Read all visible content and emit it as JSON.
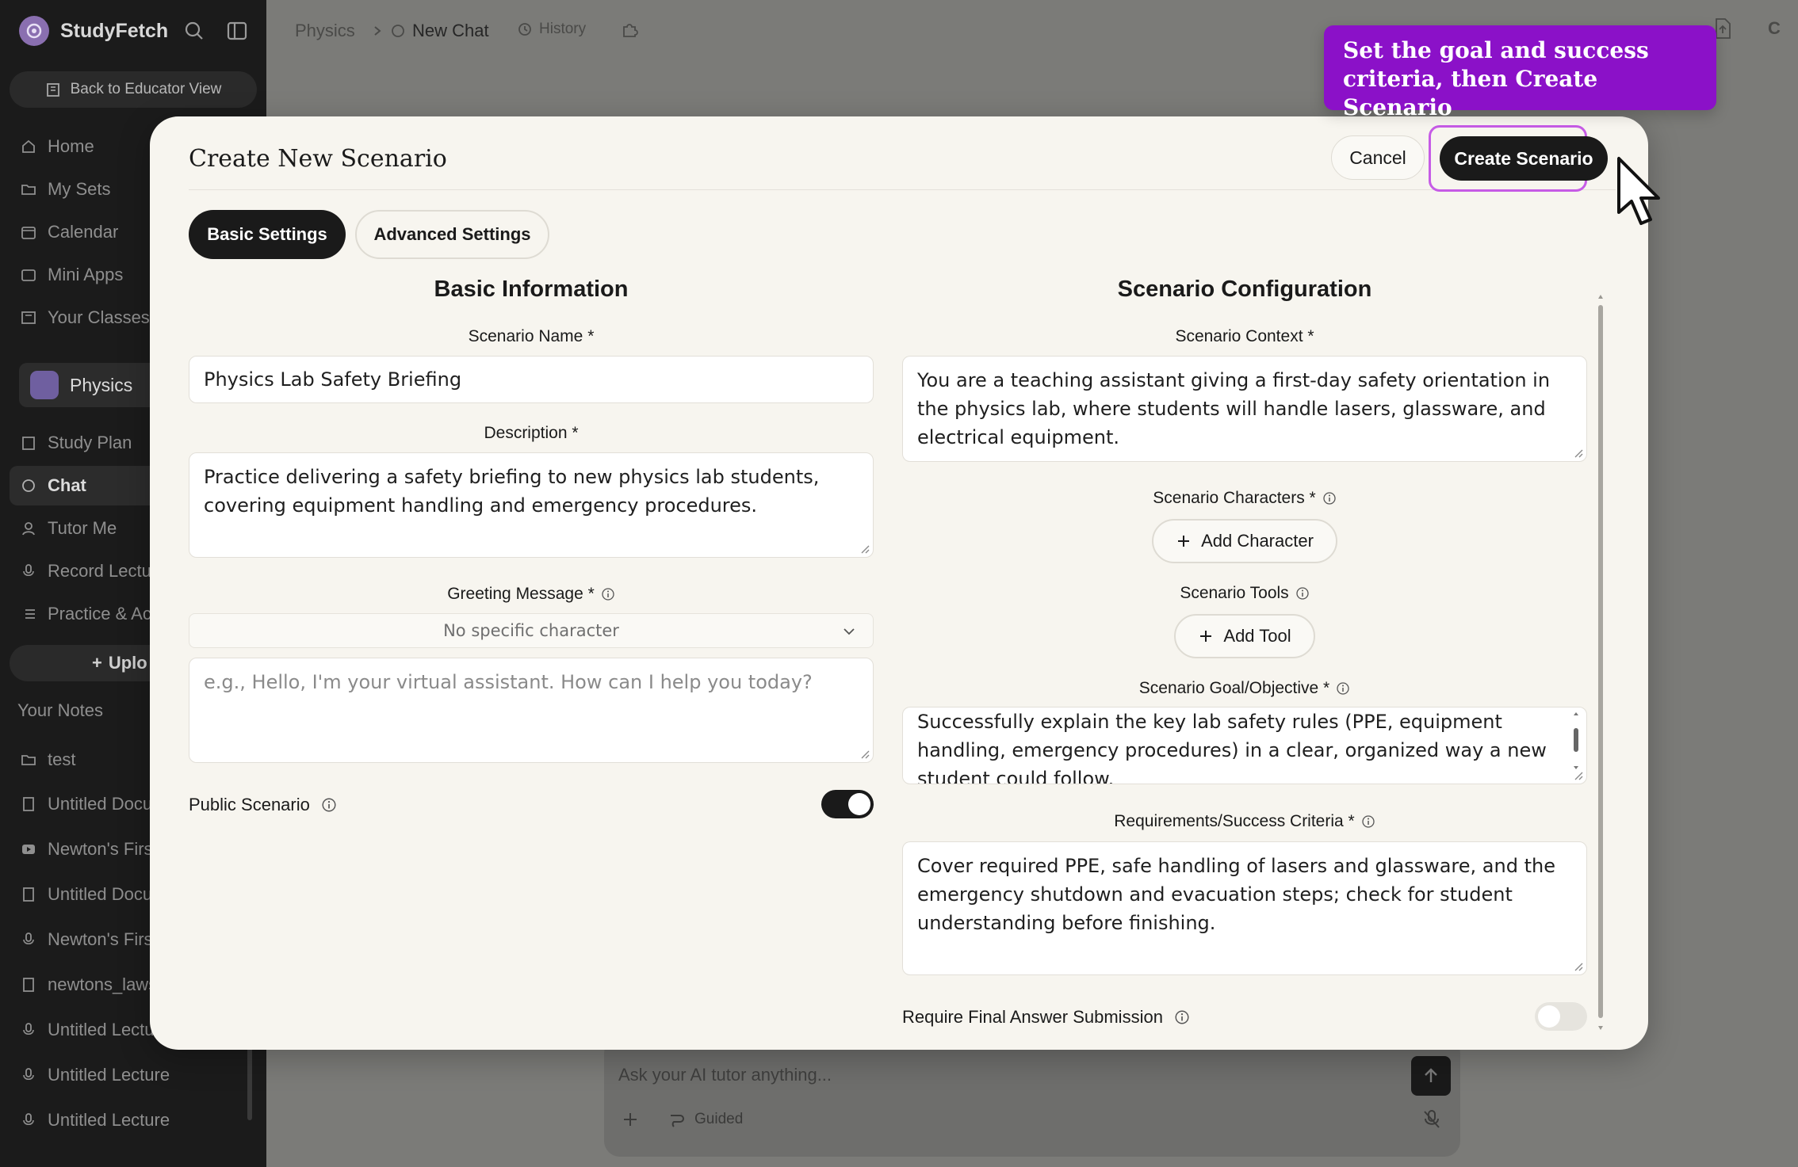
{
  "app": {
    "brand": "StudyFetch",
    "back_label": "Back to Educator View",
    "avatar_letter": "C"
  },
  "sidebar": {
    "nav": [
      "Home",
      "My Sets",
      "Calendar",
      "Mini Apps",
      "Your Classes"
    ],
    "course": "Physics",
    "course_nav": [
      "Study Plan",
      "Chat",
      "Tutor Me",
      "Record Lectu",
      "Practice & Ac"
    ],
    "upload_label": "Uplo",
    "notes_title": "Your Notes",
    "notes": [
      "test",
      "Untitled Docu",
      "Newton's First",
      "Untitled Docu",
      "Newton's First",
      "newtons_laws",
      "Untitled Lectu",
      "Untitled Lecture",
      "Untitled Lecture"
    ]
  },
  "topbar": {
    "breadcrumb_root": "Physics",
    "chat_label": "New Chat",
    "history_label": "History"
  },
  "chat": {
    "placeholder": "Ask your AI tutor anything...",
    "guided_label": "Guided"
  },
  "tooltip": {
    "text": "Set the goal and success criteria, then Create Scenario"
  },
  "modal": {
    "title": "Create New Scenario",
    "cancel_label": "Cancel",
    "create_label": "Create Scenario",
    "tabs": [
      "Basic Settings",
      "Advanced Settings"
    ],
    "basic": {
      "section_title": "Basic Information",
      "name_label": "Scenario Name *",
      "name_value": "Physics Lab Safety Briefing",
      "description_label": "Description *",
      "description_value": "Practice delivering a safety briefing to new physics lab students, covering equipment handling and emergency procedures.",
      "greeting_label": "Greeting Message *",
      "greeting_character": "No specific character",
      "greeting_placeholder": "e.g., Hello, I'm your virtual assistant. How can I help you today?",
      "public_label": "Public Scenario",
      "public_enabled": true
    },
    "config": {
      "section_title": "Scenario Configuration",
      "context_label": "Scenario Context *",
      "context_value": "You are a teaching assistant giving a first-day safety orientation in the physics lab, where students will handle lasers, glassware, and electrical equipment.",
      "characters_label": "Scenario Characters *",
      "add_character_label": "Add Character",
      "tools_label": "Scenario Tools",
      "add_tool_label": "Add Tool",
      "goal_label": "Scenario Goal/Objective *",
      "goal_value": "Successfully explain the key lab safety rules (PPE, equipment handling, emergency procedures) in a clear, organized way a new student could follow.",
      "requirements_label": "Requirements/Success Criteria *",
      "requirements_value": "Cover required PPE, safe handling of lasers and glassware, and the emergency shutdown and evacuation steps; check for student understanding before finishing.",
      "final_answer_label": "Require Final Answer Submission",
      "final_answer_enabled": false
    }
  },
  "colors": {
    "accent_purple": "#8b11c8",
    "highlight_border": "#c65be6",
    "dark": "#1a1a1a",
    "modal_bg": "#f7f5ef"
  }
}
